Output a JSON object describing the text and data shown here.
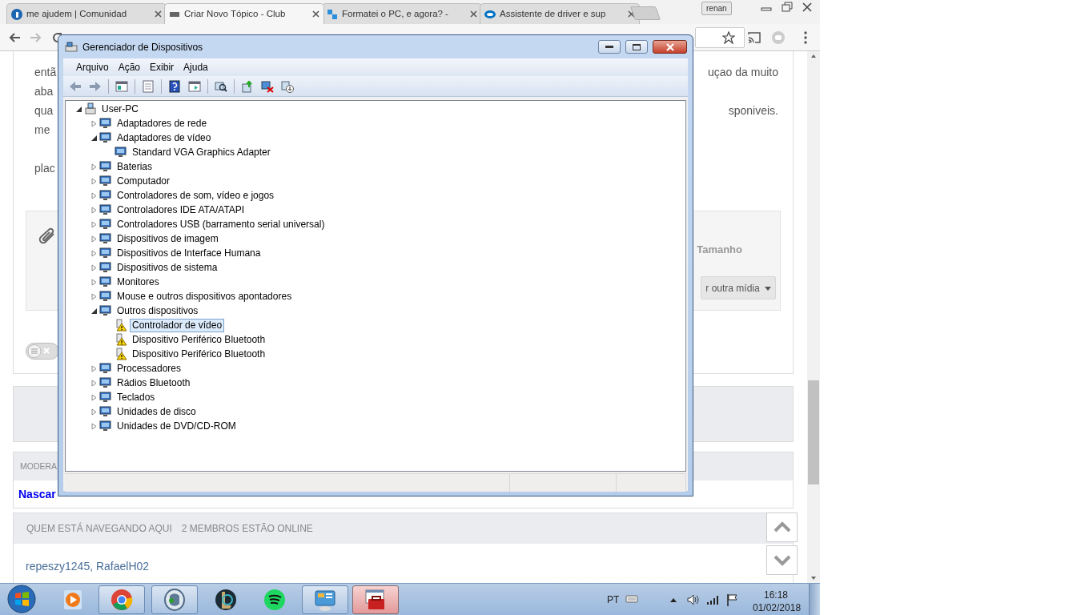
{
  "browser": {
    "tabs": [
      {
        "title": "me ajudem | Comunidad",
        "selected": false
      },
      {
        "title": "Criar Novo Tópico - Club",
        "selected": true
      },
      {
        "title": "Formatei o PC, e agora? -",
        "selected": false
      },
      {
        "title": "Assistente de driver e sup",
        "selected": false
      }
    ],
    "profile": "renan"
  },
  "page": {
    "post_lines": [
      {
        "left": "entã",
        "right": "uçao da muito",
        "paragraph_start": false
      },
      {
        "left": "aba",
        "paragraph_start": false
      },
      {
        "left": "qua",
        "right": "sponiveis.",
        "paragraph_start": false
      },
      {
        "left": "me",
        "paragraph_start": false
      },
      {
        "left": "plac",
        "paragraph_start": true
      }
    ],
    "toggle": {
      "on": false
    },
    "attachments": {
      "size_label": "Tamanho",
      "media_button": "r outra mídia"
    },
    "moderators": {
      "header": "MODERA",
      "names": "Nascar"
    },
    "online": {
      "header": "QUEM ESTÁ NAVEGANDO AQUI",
      "count": "2 MEMBROS ESTÃO ONLINE",
      "members": "repeszy1245, RafaelH02"
    }
  },
  "device_manager": {
    "title": "Gerenciador de Dispositivos",
    "menu": [
      "Arquivo",
      "Ação",
      "Exibir",
      "Ajuda"
    ],
    "tree": {
      "label": "User-PC",
      "expanded": true,
      "children": [
        {
          "label": "Adaptadores de rede",
          "expanded": false
        },
        {
          "label": "Adaptadores de vídeo",
          "expanded": true,
          "children": [
            {
              "label": "Standard VGA Graphics Adapter",
              "selected": false,
              "warning": false
            }
          ]
        },
        {
          "label": "Baterias",
          "expanded": false
        },
        {
          "label": "Computador",
          "expanded": false
        },
        {
          "label": "Controladores de som, vídeo e jogos",
          "expanded": false
        },
        {
          "label": "Controladores IDE ATA/ATAPI",
          "expanded": false
        },
        {
          "label": "Controladores USB (barramento serial universal)",
          "expanded": false
        },
        {
          "label": "Dispositivos de imagem",
          "expanded": false
        },
        {
          "label": "Dispositivos de Interface Humana",
          "expanded": false
        },
        {
          "label": "Dispositivos de sistema",
          "expanded": false
        },
        {
          "label": "Monitores",
          "expanded": false
        },
        {
          "label": "Mouse e outros dispositivos apontadores",
          "expanded": false
        },
        {
          "label": "Outros dispositivos",
          "expanded": true,
          "children": [
            {
              "label": "Controlador de vídeo",
              "selected": true,
              "warning": true
            },
            {
              "label": "Dispositivo Periférico Bluetooth",
              "selected": false,
              "warning": true
            },
            {
              "label": "Dispositivo Periférico Bluetooth",
              "selected": false,
              "warning": true
            }
          ]
        },
        {
          "label": "Processadores",
          "expanded": false
        },
        {
          "label": "Rádios Bluetooth",
          "expanded": false
        },
        {
          "label": "Teclados",
          "expanded": false
        },
        {
          "label": "Unidades de disco",
          "expanded": false
        },
        {
          "label": "Unidades de DVD/CD-ROM",
          "expanded": false
        }
      ]
    }
  },
  "taskbar": {
    "apps": [
      {
        "kind": "media",
        "running": false,
        "active": false
      },
      {
        "kind": "browser",
        "running": true,
        "active": false
      },
      {
        "kind": "voice",
        "running": true,
        "active": false
      },
      {
        "kind": "game",
        "running": false,
        "active": false
      },
      {
        "kind": "music",
        "running": false,
        "active": false
      },
      {
        "kind": "panel",
        "running": true,
        "active": false
      },
      {
        "kind": "toolbox",
        "running": true,
        "active": true
      }
    ],
    "language": "PT",
    "time": "16:18",
    "date": "01/02/2018"
  }
}
